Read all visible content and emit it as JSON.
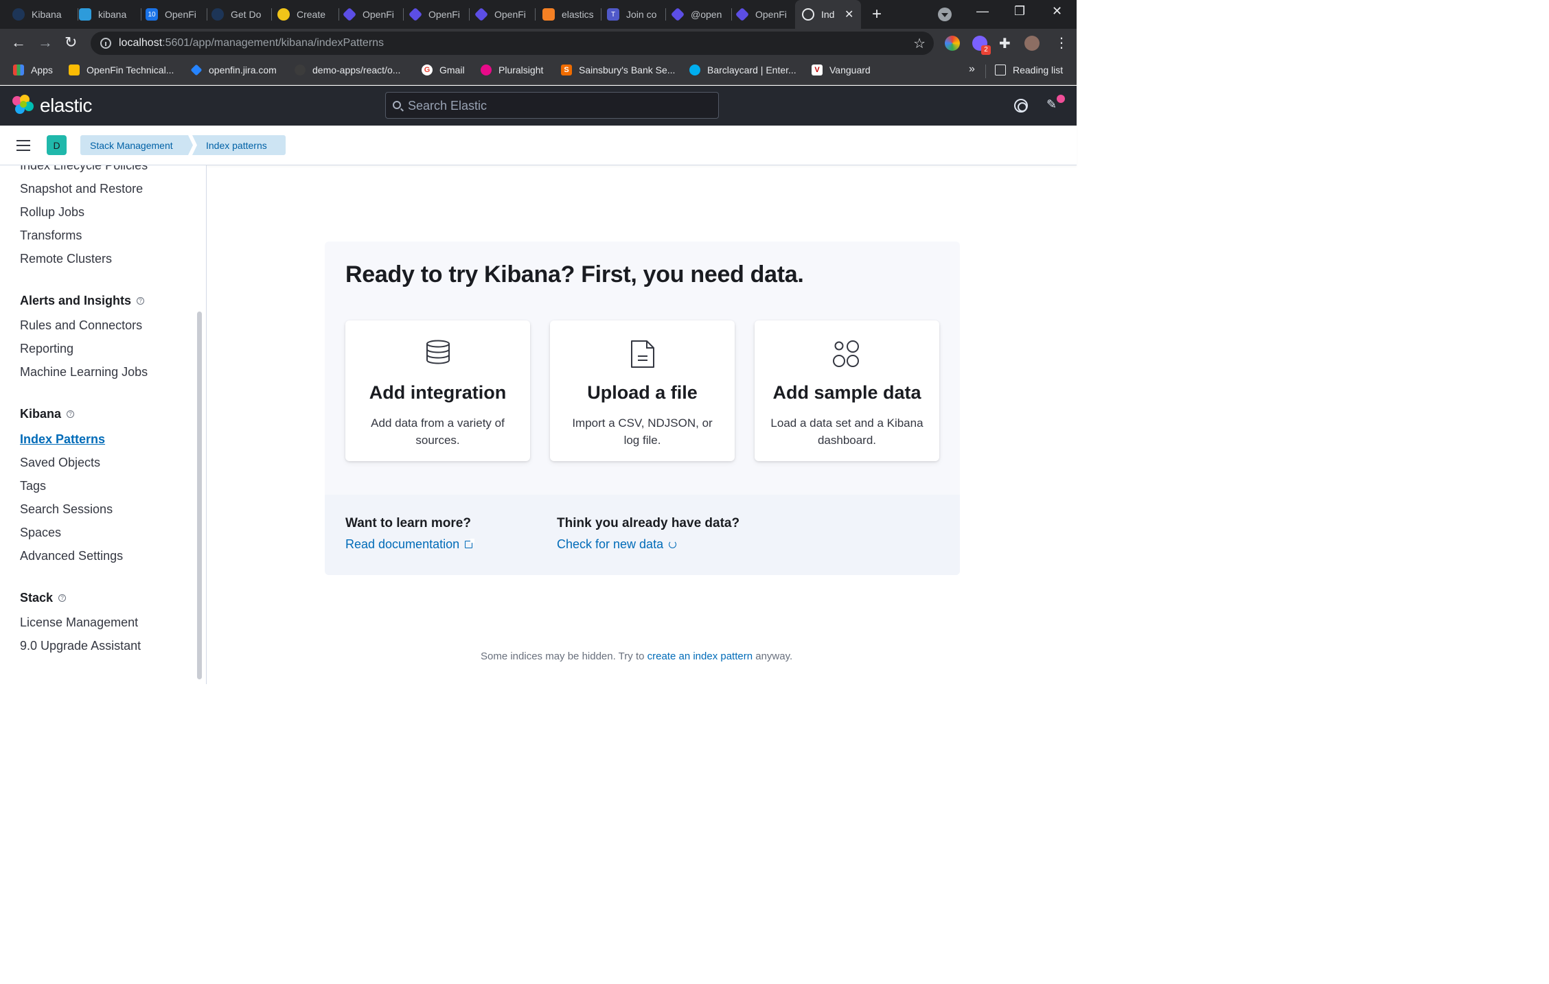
{
  "browser": {
    "tabs": [
      {
        "title": "Kibana",
        "color": "#1d3557"
      },
      {
        "title": "kibana",
        "color": "#2d9bdb"
      },
      {
        "title": "OpenFi",
        "color": "#1a73e8"
      },
      {
        "title": "Get Do",
        "color": "#1d3557"
      },
      {
        "title": "Create",
        "color": "#f0c419"
      },
      {
        "title": "OpenFi",
        "color": "#5c4ee5"
      },
      {
        "title": "OpenFi",
        "color": "#5c4ee5"
      },
      {
        "title": "OpenFi",
        "color": "#5c4ee5"
      },
      {
        "title": "elastics",
        "color": "#f48024"
      },
      {
        "title": "Join co",
        "color": "#5059c9"
      },
      {
        "title": "@open",
        "color": "#5c4ee5"
      },
      {
        "title": "OpenFi",
        "color": "#5c4ee5"
      },
      {
        "title": "Ind",
        "color": "#e8eaed"
      }
    ],
    "url_host": "localhost",
    "url_rest": ":5601/app/management/kibana/indexPatterns",
    "extension_badge": "2",
    "bookmarks": [
      {
        "label": "Apps",
        "color": "#ea4335"
      },
      {
        "label": "OpenFin Technical...",
        "color": "#fbbc04"
      },
      {
        "label": "openfin.jira.com",
        "color": "#2684ff"
      },
      {
        "label": "demo-apps/react/o...",
        "color": "#3c3c3c"
      },
      {
        "label": "Gmail",
        "color": "#ffffff"
      },
      {
        "label": "Pluralsight",
        "color": "#e80a89"
      },
      {
        "label": "Sainsbury's Bank Se...",
        "color": "#f06c00"
      },
      {
        "label": "Barclaycard | Enter...",
        "color": "#00aeef"
      },
      {
        "label": "Vanguard",
        "color": "#c00000"
      }
    ],
    "bookmarks_more": "»",
    "reading_list": "Reading list"
  },
  "kibana": {
    "brand": "elastic",
    "search_placeholder": "Search Elastic",
    "space_initial": "D",
    "breadcrumbs": [
      "Stack Management",
      "Index patterns"
    ]
  },
  "sidenav": {
    "items_top": [
      "Index Lifecycle Policies",
      "Snapshot and Restore",
      "Rollup Jobs",
      "Transforms",
      "Remote Clusters"
    ],
    "groups": [
      {
        "title": "Alerts and Insights",
        "items": [
          "Rules and Connectors",
          "Reporting",
          "Machine Learning Jobs"
        ]
      },
      {
        "title": "Kibana",
        "items": [
          "Index Patterns",
          "Saved Objects",
          "Tags",
          "Search Sessions",
          "Spaces",
          "Advanced Settings"
        ]
      },
      {
        "title": "Stack",
        "items": [
          "License Management",
          "9.0 Upgrade Assistant"
        ]
      }
    ],
    "current": "Index Patterns"
  },
  "main": {
    "title": "Ready to try Kibana? First, you need data.",
    "cards": [
      {
        "icon": "database-icon",
        "title": "Add integration",
        "desc": "Add data from a variety of sources."
      },
      {
        "icon": "document-icon",
        "title": "Upload a file",
        "desc": "Import a CSV, NDJSON, or log file."
      },
      {
        "icon": "sample-data-icon",
        "title": "Add sample data",
        "desc": "Load a data set and a Kibana dashboard."
      }
    ],
    "learn_title": "Want to learn more?",
    "learn_link": "Read documentation",
    "have_data_title": "Think you already have data?",
    "have_data_link": "Check for new data",
    "hint_prefix": "Some indices may be hidden. Try to ",
    "hint_link": "create an index pattern",
    "hint_suffix": " anyway."
  }
}
